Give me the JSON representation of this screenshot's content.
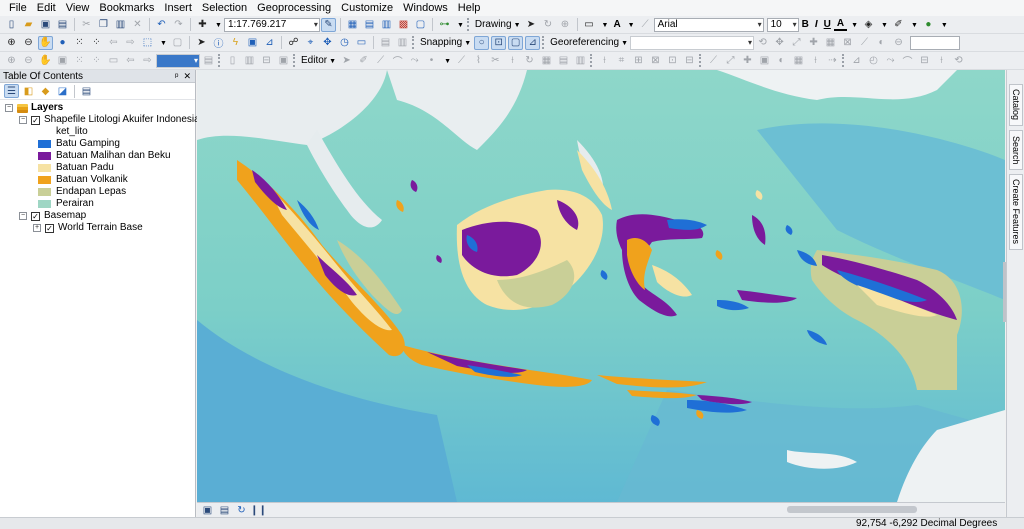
{
  "menu": [
    "File",
    "Edit",
    "View",
    "Bookmarks",
    "Insert",
    "Selection",
    "Geoprocessing",
    "Customize",
    "Windows",
    "Help"
  ],
  "toolbar": {
    "scale_value": "1:17.769.217",
    "drawing_label": "Drawing",
    "font_name": "Arial",
    "font_size": "10",
    "bold": "B",
    "italic": "I",
    "underline": "U",
    "text_tool": "A",
    "snapping_label": "Snapping",
    "georeferencing_label": "Georeferencing",
    "editor_label": "Editor"
  },
  "toc": {
    "title": "Table Of Contents",
    "pin": "ᵖ",
    "close": "×",
    "layers_label": "Layers",
    "shapefile_label": "Shapefile Litologi Akuifer Indonesia_ESDM",
    "field_label": "ket_lito",
    "legend": [
      {
        "label": "Batu Gamping",
        "color": "#1f6fd6"
      },
      {
        "label": "Batuan Malihan dan Beku",
        "color": "#7a1a9c"
      },
      {
        "label": "Batuan Padu",
        "color": "#f6e2a3"
      },
      {
        "label": "Batuan Volkanik",
        "color": "#f0a21c"
      },
      {
        "label": "Endapan Lepas",
        "color": "#c9cf97"
      },
      {
        "label": "Perairan",
        "color": "#9fd6c4"
      }
    ],
    "basemap_label": "Basemap",
    "terrain_label": "World Terrain Base"
  },
  "dock": {
    "catalog": "Catalog",
    "search": "Search",
    "create_features": "Create Features"
  },
  "status": {
    "coords": "92,754  -6,292 Decimal Degrees"
  },
  "colors": {
    "sea_shallow": "#7fd1c8",
    "sea_deep": "#5bb8d0",
    "land_terrain": "#e9eef0",
    "limestone": "#1f6fd6",
    "metamorphic": "#7a1a9c",
    "solid_rock": "#f6e2a3",
    "volcanic": "#f0a21c",
    "loose_deposits": "#c9cf97"
  }
}
